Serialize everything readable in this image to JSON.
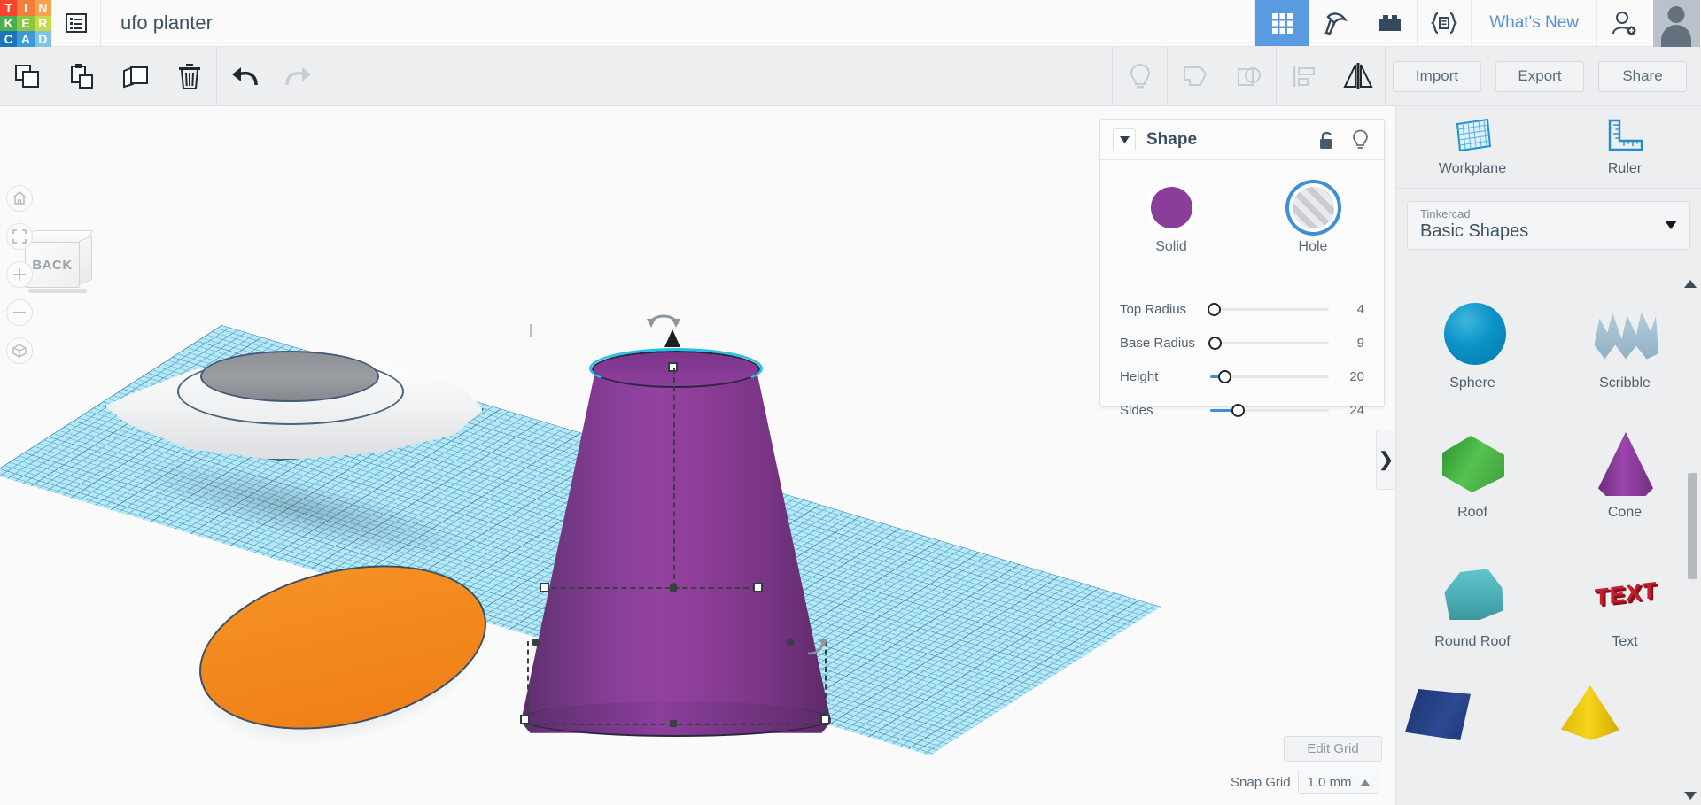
{
  "app": {
    "name": "Tinkercad",
    "logo_letters": [
      {
        "ch": "T",
        "color": "#f4442e"
      },
      {
        "ch": "I",
        "color": "#f57f3a"
      },
      {
        "ch": "N",
        "color": "#f8a14a"
      },
      {
        "ch": "K",
        "color": "#4caf50"
      },
      {
        "ch": "E",
        "color": "#8dc63f"
      },
      {
        "ch": "R",
        "color": "#c8d94a"
      },
      {
        "ch": "C",
        "color": "#1b75bb"
      },
      {
        "ch": "A",
        "color": "#3c9bd6"
      },
      {
        "ch": "D",
        "color": "#7fc4e8"
      }
    ],
    "design_title": "ufo planter",
    "documents_icon": "documents-list-icon"
  },
  "topbar": {
    "icons": [
      {
        "name": "grid-apps-icon",
        "active": true
      },
      {
        "name": "minecraft-pickaxe-icon",
        "active": false
      },
      {
        "name": "lego-brick-icon",
        "active": false
      },
      {
        "name": "codeblocks-icon",
        "active": false
      }
    ],
    "whats_new_label": "What's New",
    "invite_icon": "add-person-icon",
    "avatar": "user-avatar"
  },
  "toolbar": {
    "left_buttons": [
      {
        "name": "copy-button",
        "icon": "copy-icon"
      },
      {
        "name": "paste-button",
        "icon": "paste-icon"
      },
      {
        "name": "duplicate-button",
        "icon": "duplicate-icon"
      },
      {
        "name": "delete-button",
        "icon": "trash-icon"
      },
      {
        "name": "undo-button",
        "icon": "undo-arrow-icon"
      },
      {
        "name": "redo-button",
        "icon": "redo-arrow-icon"
      }
    ],
    "right_buttons": [
      {
        "name": "hint-button",
        "icon": "lightbulb-icon",
        "enabled": false
      },
      {
        "name": "group-button",
        "icon": "group-icon",
        "enabled": false
      },
      {
        "name": "ungroup-button",
        "icon": "ungroup-icon",
        "enabled": false
      },
      {
        "name": "align-button",
        "icon": "align-icon",
        "enabled": false
      },
      {
        "name": "mirror-button",
        "icon": "mirror-flip-icon",
        "enabled": true
      }
    ],
    "import_label": "Import",
    "export_label": "Export",
    "share_label": "Share"
  },
  "viewport": {
    "viewcube_face": "BACK",
    "nav_buttons": [
      {
        "name": "home-view-button",
        "icon": "home-icon"
      },
      {
        "name": "fit-to-view-button",
        "icon": "fit-frame-icon"
      },
      {
        "name": "zoom-in-button",
        "icon": "plus-icon"
      },
      {
        "name": "zoom-out-button",
        "icon": "minus-icon"
      },
      {
        "name": "ortho-perspective-button",
        "icon": "cube-view-icon"
      }
    ],
    "panel_toggle_icon": "chevron-right-icon",
    "edit_grid_label": "Edit Grid",
    "snap_grid_label": "Snap Grid",
    "snap_grid_value": "1.0 mm",
    "snap_caret": "caret-up-icon",
    "objects": [
      {
        "name": "ufo-saucer-object",
        "color": "#f0f1f2"
      },
      {
        "name": "orange-disc-object",
        "color": "#f08a1e"
      },
      {
        "name": "purple-cone-object",
        "color": "#8b3d9c",
        "selected": true
      }
    ],
    "workplane_color": "#b5e6f5"
  },
  "inspector": {
    "title": "Shape",
    "collapse_icon": "caret-down-icon",
    "lock_icon": "unlock-icon",
    "hint_icon": "lightbulb-icon",
    "solid_label": "Solid",
    "hole_label": "Hole",
    "solid_color": "#8b3d9c",
    "selected_mode": "Hole",
    "sliders": [
      {
        "label": "Top Radius",
        "value": "4",
        "fill_pct": 0,
        "knob_pct": 2
      },
      {
        "label": "Base Radius",
        "value": "9",
        "fill_pct": 0,
        "knob_pct": 6
      },
      {
        "label": "Height",
        "value": "20",
        "fill_pct": 14,
        "knob_pct": 14
      },
      {
        "label": "Sides",
        "value": "24",
        "fill_pct": 30,
        "knob_pct": 30
      }
    ]
  },
  "sidebar": {
    "tools": [
      {
        "label": "Workplane",
        "icon": "workplane-grid-icon"
      },
      {
        "label": "Ruler",
        "icon": "ruler-icon"
      }
    ],
    "library": {
      "source": "Tinkercad",
      "collection": "Basic Shapes",
      "caret": "caret-down-icon"
    },
    "shapes": [
      {
        "label": "Sphere",
        "thumb": "th-sphere",
        "color": "#0b93c6"
      },
      {
        "label": "Scribble",
        "thumb": "th-scribble",
        "color": "#8fb0c4"
      },
      {
        "label": "Roof",
        "thumb": "th-roof",
        "color": "#54c24f"
      },
      {
        "label": "Cone",
        "thumb": "th-cone",
        "color": "#9b45ad"
      },
      {
        "label": "Round Roof",
        "thumb": "th-roundroof",
        "color": "#4aacb6"
      },
      {
        "label": "Text",
        "thumb": "th-text",
        "color": "#c41f2e",
        "text": "TEXT"
      },
      {
        "label": "",
        "thumb": "th-box",
        "color": "#2c4a93"
      },
      {
        "label": "",
        "thumb": "th-pyramid",
        "color": "#f5d51a"
      }
    ],
    "scroll_up_icon": "caret-up-icon",
    "scroll_down_icon": "caret-down-icon"
  }
}
